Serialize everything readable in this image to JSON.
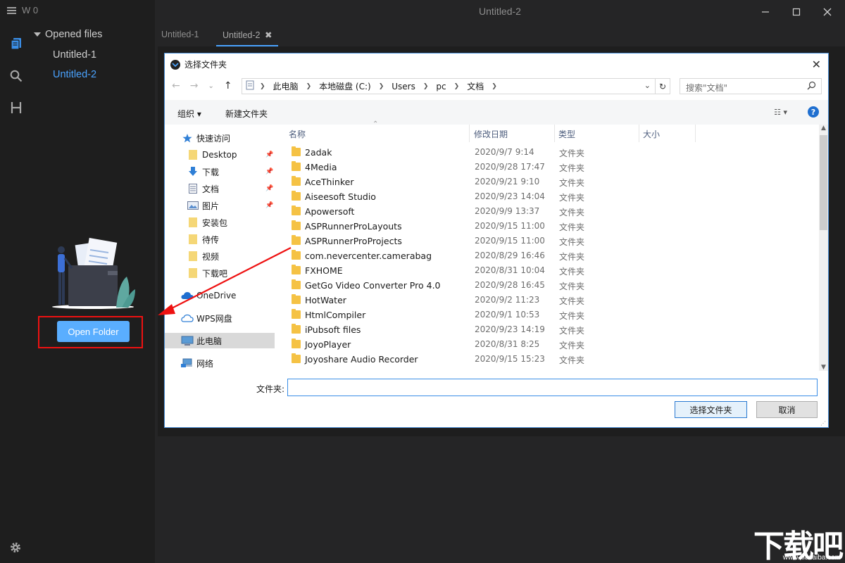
{
  "app": {
    "workspace_label": "W 0",
    "window_title": "Untitled-2",
    "open_folder_button": "Open Folder"
  },
  "sidebar": {
    "section_title": "Opened files",
    "files": [
      {
        "label": "Untitled-1",
        "active": false
      },
      {
        "label": "Untitled-2",
        "active": true
      }
    ]
  },
  "tabs": [
    {
      "label": "Untitled-1",
      "active": false
    },
    {
      "label": "Untitled-2",
      "active": true,
      "close_glyph": "✖"
    }
  ],
  "dialog": {
    "title": "选择文件夹",
    "breadcrumbs": [
      "此电脑",
      "本地磁盘 (C:)",
      "Users",
      "pc",
      "文档"
    ],
    "search_placeholder": "搜索\"文档\"",
    "toolbar": {
      "organize": "组织 ▾",
      "new_folder": "新建文件夹"
    },
    "nav": [
      {
        "label": "快速访问",
        "icon": "star-icon",
        "pinned": false
      },
      {
        "label": "Desktop",
        "icon": "folder-icon",
        "pinned": true
      },
      {
        "label": "下载",
        "icon": "download-icon",
        "pinned": true
      },
      {
        "label": "文档",
        "icon": "document-icon",
        "pinned": true
      },
      {
        "label": "图片",
        "icon": "picture-icon",
        "pinned": true
      },
      {
        "label": "安装包",
        "icon": "folder-icon",
        "pinned": false
      },
      {
        "label": "待传",
        "icon": "folder-icon",
        "pinned": false
      },
      {
        "label": "视频",
        "icon": "folder-icon",
        "pinned": false
      },
      {
        "label": "下载吧",
        "icon": "folder-icon",
        "pinned": false
      },
      {
        "label": "OneDrive",
        "icon": "cloud-icon",
        "pinned": false
      },
      {
        "label": "WPS网盘",
        "icon": "cloud-outline-icon",
        "pinned": false
      },
      {
        "label": "此电脑",
        "icon": "computer-icon",
        "pinned": false,
        "selected": true
      },
      {
        "label": "网络",
        "icon": "network-icon",
        "pinned": false
      }
    ],
    "columns": {
      "name": "名称",
      "modified": "修改日期",
      "type": "类型",
      "size": "大小"
    },
    "rows": [
      {
        "name": "2adak",
        "date": "2020/9/7 9:14",
        "type": "文件夹"
      },
      {
        "name": "4Media",
        "date": "2020/9/28 17:47",
        "type": "文件夹"
      },
      {
        "name": "AceThinker",
        "date": "2020/9/21 9:10",
        "type": "文件夹"
      },
      {
        "name": "Aiseesoft Studio",
        "date": "2020/9/23 14:04",
        "type": "文件夹"
      },
      {
        "name": "Apowersoft",
        "date": "2020/9/9 13:37",
        "type": "文件夹"
      },
      {
        "name": "ASPRunnerProLayouts",
        "date": "2020/9/15 11:00",
        "type": "文件夹"
      },
      {
        "name": "ASPRunnerProProjects",
        "date": "2020/9/15 11:00",
        "type": "文件夹"
      },
      {
        "name": "com.nevercenter.camerabag",
        "date": "2020/8/29 16:46",
        "type": "文件夹"
      },
      {
        "name": "FXHOME",
        "date": "2020/8/31 10:04",
        "type": "文件夹"
      },
      {
        "name": "GetGo Video Converter Pro 4.0",
        "date": "2020/9/28 16:45",
        "type": "文件夹"
      },
      {
        "name": "HotWater",
        "date": "2020/9/2 11:23",
        "type": "文件夹"
      },
      {
        "name": "HtmlCompiler",
        "date": "2020/9/1 10:53",
        "type": "文件夹"
      },
      {
        "name": "iPubsoft files",
        "date": "2020/9/23 14:19",
        "type": "文件夹"
      },
      {
        "name": "JoyoPlayer",
        "date": "2020/8/31 8:25",
        "type": "文件夹"
      },
      {
        "name": "Joyoshare Audio Recorder",
        "date": "2020/9/15 15:23",
        "type": "文件夹"
      }
    ],
    "folder_label": "文件夹:",
    "folder_value": "",
    "select_button": "选择文件夹",
    "cancel_button": "取消"
  },
  "watermark": {
    "big": "下载吧",
    "small": "www.xiazaiba.com"
  },
  "colors": {
    "accent": "#4aa3ff",
    "button": "#5aaeff",
    "highlight_box": "#ee1111",
    "folder": "#f5c244"
  }
}
